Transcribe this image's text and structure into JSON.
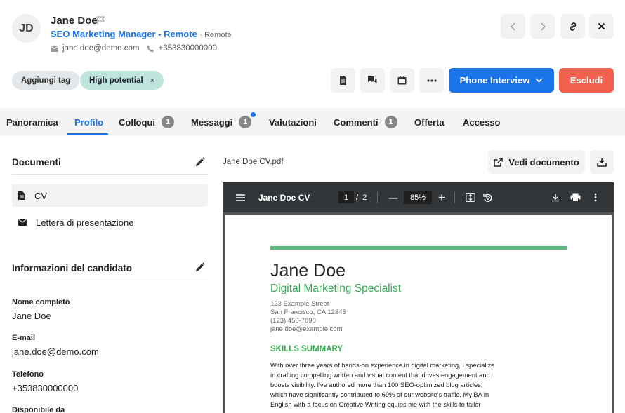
{
  "header": {
    "initials": "JD",
    "name": "Jane Doe",
    "job_title": "SEO Marketing Manager - Remote",
    "job_mode": "· Remote",
    "email": "jane.doe@demo.com",
    "phone": "+353830000000"
  },
  "tags": {
    "add_label": "Aggiungi tag",
    "items": [
      {
        "label": "High potential",
        "remove": "×"
      }
    ]
  },
  "actions": {
    "stage_label": "Phone Interview",
    "reject_label": "Escludi"
  },
  "tabs": [
    {
      "label": "Panoramica"
    },
    {
      "label": "Profilo",
      "active": true
    },
    {
      "label": "Colloqui",
      "count": "1"
    },
    {
      "label": "Messaggi",
      "count": "1",
      "unread": true
    },
    {
      "label": "Valutazioni"
    },
    {
      "label": "Commenti",
      "count": "1"
    },
    {
      "label": "Offerta"
    },
    {
      "label": "Accesso"
    }
  ],
  "documents": {
    "title": "Documenti",
    "items": [
      {
        "label": "CV",
        "icon": "file-icon",
        "selected": true
      },
      {
        "label": "Lettera di presentazione",
        "icon": "envelope-icon"
      }
    ]
  },
  "candidate_info": {
    "title": "Informazioni del candidato",
    "fields": [
      {
        "label": "Nome completo",
        "value": "Jane Doe"
      },
      {
        "label": "E-mail",
        "value": "jane.doe@demo.com"
      },
      {
        "label": "Telefono",
        "value": "+353830000000"
      },
      {
        "label": "Disponibile da",
        "value": ""
      }
    ]
  },
  "viewer_panel": {
    "file_name": "Jane Doe CV.pdf",
    "view_label": "Vedi documento"
  },
  "pdf_viewer": {
    "title": "Jane Doe CV",
    "current_page": "1",
    "page_sep": "/",
    "total_pages": "2",
    "zoom": "85%",
    "minus": "—",
    "plus": "+"
  },
  "cv": {
    "name": "Jane Doe",
    "role": "Digital Marketing Specialist",
    "address1": "123 Example Street",
    "address2": "San Francisco, CA 12345",
    "phone": "(123) 456-7890",
    "email": "jane.doe@example.com",
    "section_title": "SKILLS SUMMARY",
    "summary_lines": [
      "With over three years of hands-on experience in digital marketing, I specialize",
      "in crafting compelling written and visual content that drives engagement and",
      "boosts visibility. I've authored more than 100 SEO-optimized blog articles,",
      "which have significantly contributed to 69% of our website's traffic. My BA in",
      "English with a focus on Creative Writing equips me with the skills to tailor"
    ]
  },
  "colors": {
    "accent": "#1a73e8",
    "danger": "#f0604d",
    "tag_hp": "#bfe4dc",
    "cv_green": "#3aa955"
  }
}
